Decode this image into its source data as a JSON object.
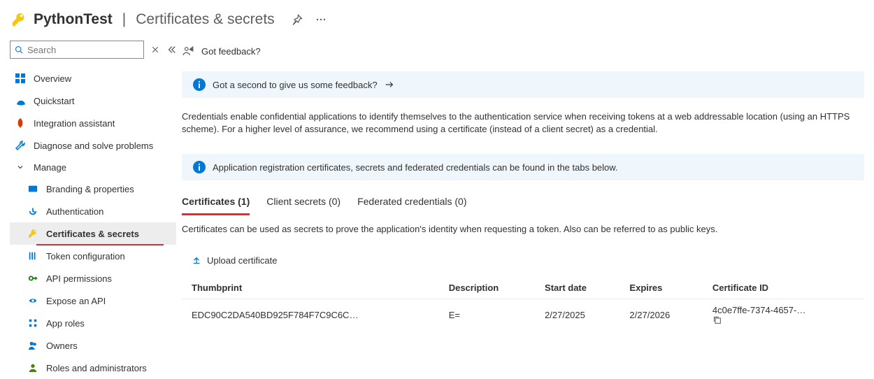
{
  "header": {
    "app_name": "PythonTest",
    "page_name": "Certificates & secrets"
  },
  "search": {
    "placeholder": "Search"
  },
  "top_bar": {
    "feedback": "Got feedback?"
  },
  "sidebar": {
    "items": [
      {
        "label": "Overview",
        "icon": "overview"
      },
      {
        "label": "Quickstart",
        "icon": "quickstart"
      },
      {
        "label": "Integration assistant",
        "icon": "rocket"
      },
      {
        "label": "Diagnose and solve problems",
        "icon": "wrench"
      }
    ],
    "manage_label": "Manage",
    "manage_items": [
      {
        "label": "Branding & properties",
        "icon": "branding"
      },
      {
        "label": "Authentication",
        "icon": "auth"
      },
      {
        "label": "Certificates & secrets",
        "icon": "key",
        "selected": true,
        "underline": true
      },
      {
        "label": "Token configuration",
        "icon": "token"
      },
      {
        "label": "API permissions",
        "icon": "api"
      },
      {
        "label": "Expose an API",
        "icon": "expose"
      },
      {
        "label": "App roles",
        "icon": "roles"
      },
      {
        "label": "Owners",
        "icon": "owners"
      },
      {
        "label": "Roles and administrators",
        "icon": "admins"
      }
    ]
  },
  "banner1": "Got a second to give us some feedback?",
  "description": "Credentials enable confidential applications to identify themselves to the authentication service when receiving tokens at a web addressable location (using an HTTPS scheme). For a higher level of assurance, we recommend using a certificate (instead of a client secret) as a credential.",
  "banner2": "Application registration certificates, secrets and federated credentials can be found in the tabs below.",
  "tabs": [
    {
      "label": "Certificates (1)",
      "active": true
    },
    {
      "label": "Client secrets (0)"
    },
    {
      "label": "Federated credentials (0)"
    }
  ],
  "tab_desc": "Certificates can be used as secrets to prove the application's identity when requesting a token. Also can be referred to as public keys.",
  "upload_label": "Upload certificate",
  "table": {
    "headers": [
      "Thumbprint",
      "Description",
      "Start date",
      "Expires",
      "Certificate ID"
    ],
    "rows": [
      {
        "thumbprint": "EDC90C2DA540BD925F784F7C9C6C…",
        "description": "E=",
        "start": "2/27/2025",
        "expires": "2/27/2026",
        "cert_id": "4c0e7ffe-7374-4657-…"
      }
    ]
  }
}
